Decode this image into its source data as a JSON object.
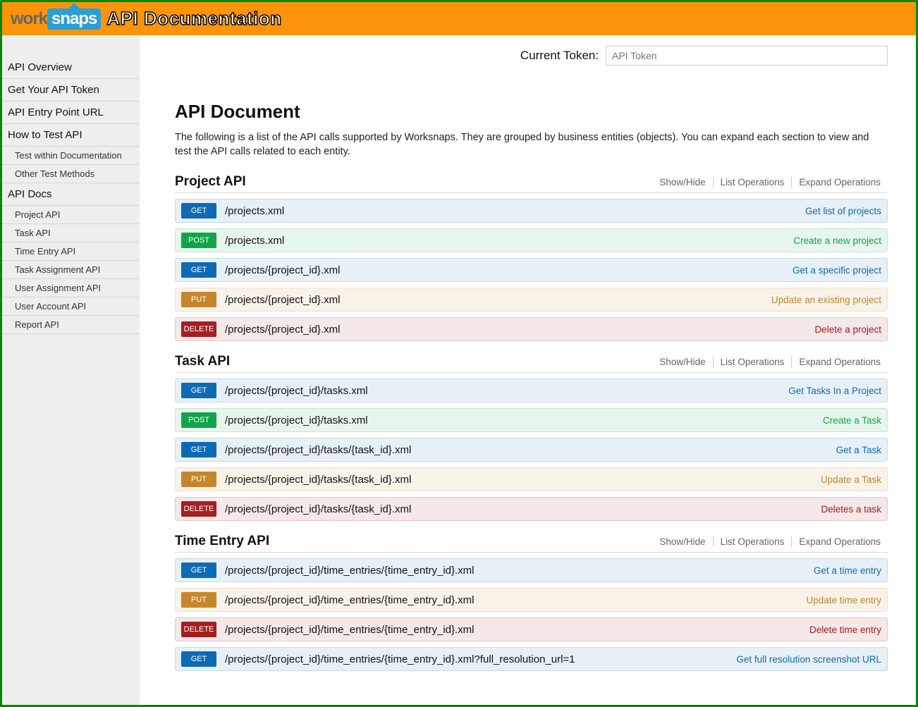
{
  "header": {
    "logo_part1": "work",
    "logo_part2": "snaps",
    "title": "API Documentation"
  },
  "token": {
    "label": "Current Token:",
    "placeholder": "API Token"
  },
  "sidebar": {
    "items": [
      {
        "label": "API Overview",
        "type": "item"
      },
      {
        "label": "Get Your API Token",
        "type": "item"
      },
      {
        "label": "API Entry Point URL",
        "type": "item"
      },
      {
        "label": "How to Test API",
        "type": "item"
      },
      {
        "label": "Test within Documentation",
        "type": "sub"
      },
      {
        "label": "Other Test Methods",
        "type": "sub"
      },
      {
        "label": "API Docs",
        "type": "item"
      },
      {
        "label": "Project API",
        "type": "sub"
      },
      {
        "label": "Task API",
        "type": "sub"
      },
      {
        "label": "Time Entry API",
        "type": "sub"
      },
      {
        "label": "Task Assignment API",
        "type": "sub"
      },
      {
        "label": "User Assignment API",
        "type": "sub"
      },
      {
        "label": "User Account API",
        "type": "sub"
      },
      {
        "label": "Report API",
        "type": "sub"
      }
    ]
  },
  "page": {
    "title": "API Document",
    "intro": "The following is a list of the API calls supported by Worksnaps. They are grouped by business entities (objects). You can expand each section to view and test the API calls related to each entity."
  },
  "section_ops": {
    "show_hide": "Show/Hide",
    "list": "List Operations",
    "expand": "Expand Operations"
  },
  "sections": [
    {
      "title": "Project API",
      "endpoints": [
        {
          "method": "GET",
          "path": "/projects.xml",
          "desc": "Get list of projects"
        },
        {
          "method": "POST",
          "path": "/projects.xml",
          "desc": "Create a new project"
        },
        {
          "method": "GET",
          "path": "/projects/{project_id}.xml",
          "desc": "Get a specific project"
        },
        {
          "method": "PUT",
          "path": "/projects/{project_id}.xml",
          "desc": "Update an existing project"
        },
        {
          "method": "DELETE",
          "path": "/projects/{project_id}.xml",
          "desc": "Delete a project"
        }
      ]
    },
    {
      "title": "Task API",
      "endpoints": [
        {
          "method": "GET",
          "path": "/projects/{project_id}/tasks.xml",
          "desc": "Get Tasks In a Project"
        },
        {
          "method": "POST",
          "path": "/projects/{project_id}/tasks.xml",
          "desc": "Create a Task"
        },
        {
          "method": "GET",
          "path": "/projects/{project_id}/tasks/{task_id}.xml",
          "desc": "Get a Task"
        },
        {
          "method": "PUT",
          "path": "/projects/{project_id}/tasks/{task_id}.xml",
          "desc": "Update a Task"
        },
        {
          "method": "DELETE",
          "path": "/projects/{project_id}/tasks/{task_id}.xml",
          "desc": "Deletes a task"
        }
      ]
    },
    {
      "title": "Time Entry API",
      "endpoints": [
        {
          "method": "GET",
          "path": "/projects/{project_id}/time_entries/{time_entry_id}.xml",
          "desc": "Get a time entry"
        },
        {
          "method": "PUT",
          "path": "/projects/{project_id}/time_entries/{time_entry_id}.xml",
          "desc": "Update time entry"
        },
        {
          "method": "DELETE",
          "path": "/projects/{project_id}/time_entries/{time_entry_id}.xml",
          "desc": "Delete time entry"
        },
        {
          "method": "GET",
          "path": "/projects/{project_id}/time_entries/{time_entry_id}.xml?full_resolution_url=1",
          "desc": "Get full resolution screenshot URL"
        }
      ]
    }
  ]
}
